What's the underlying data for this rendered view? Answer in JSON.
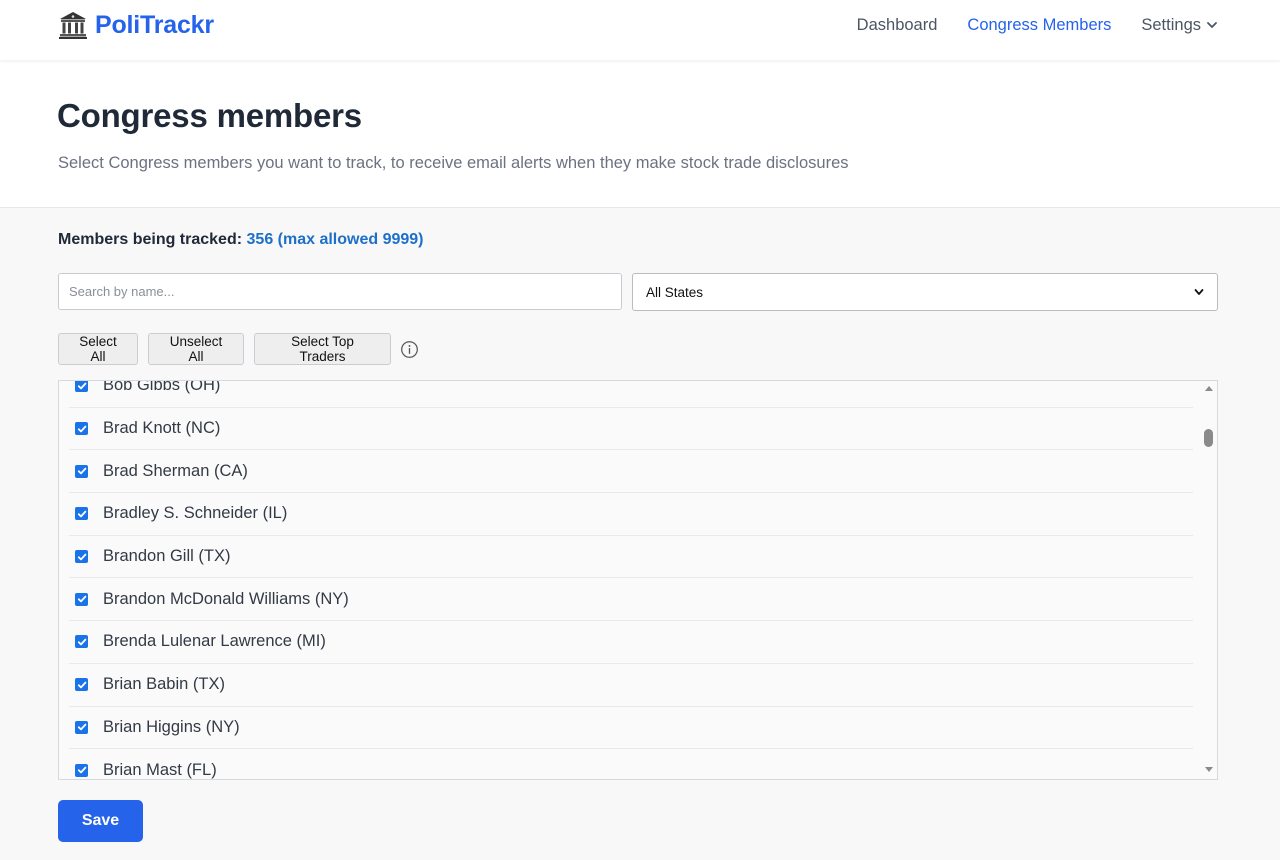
{
  "brand": {
    "name": "PoliTrackr",
    "icon": "capitol-building-icon"
  },
  "nav": {
    "dashboard": "Dashboard",
    "congress_members": "Congress Members",
    "settings": "Settings",
    "active": "Congress Members"
  },
  "header": {
    "title": "Congress members",
    "subtitle": "Select Congress members you want to track, to receive email alerts when they make stock trade disclosures"
  },
  "summary": {
    "label": "Members being tracked:",
    "count_text": "356 (max allowed 9999)"
  },
  "filters": {
    "search_placeholder": "Search by name...",
    "search_value": "",
    "state_selected": "All States"
  },
  "actions": {
    "select_all": "Select All",
    "unselect_all": "Unselect All",
    "select_top_traders": "Select Top Traders",
    "info_icon": "info-circle-icon"
  },
  "members": [
    {
      "label": "Bob Gibbs (OH)",
      "checked": true
    },
    {
      "label": "Brad Knott (NC)",
      "checked": true
    },
    {
      "label": "Brad Sherman (CA)",
      "checked": true
    },
    {
      "label": "Bradley S. Schneider (IL)",
      "checked": true
    },
    {
      "label": "Brandon Gill (TX)",
      "checked": true
    },
    {
      "label": "Brandon McDonald Williams (NY)",
      "checked": true
    },
    {
      "label": "Brenda Lulenar Lawrence (MI)",
      "checked": true
    },
    {
      "label": "Brian Babin (TX)",
      "checked": true
    },
    {
      "label": "Brian Higgins (NY)",
      "checked": true
    },
    {
      "label": "Brian Mast (FL)",
      "checked": true
    }
  ],
  "save": {
    "label": "Save"
  },
  "colors": {
    "accent": "#2563eb",
    "count": "#1d6fc9",
    "checkbox": "#1a73e8"
  }
}
